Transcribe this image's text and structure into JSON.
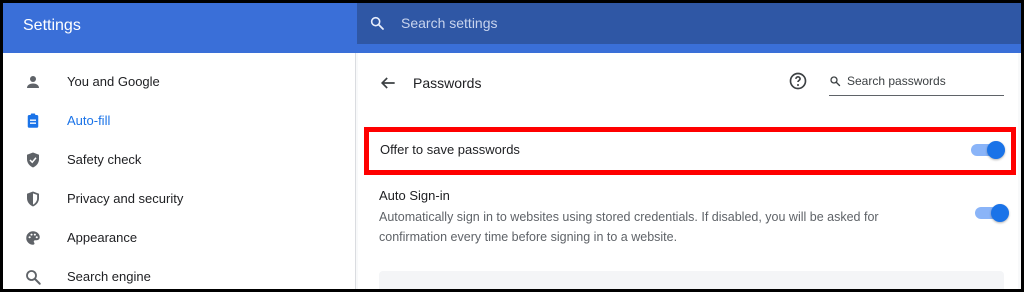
{
  "header": {
    "app_title": "Settings",
    "search_placeholder": "Search settings",
    "search_icon": "search-icon"
  },
  "sidebar": {
    "items": [
      {
        "label": "You and Google",
        "icon": "person-icon",
        "active": false
      },
      {
        "label": "Auto-fill",
        "icon": "clipboard-icon",
        "active": true
      },
      {
        "label": "Safety check",
        "icon": "shield-check-icon",
        "active": false
      },
      {
        "label": "Privacy and security",
        "icon": "shield-icon",
        "active": false
      },
      {
        "label": "Appearance",
        "icon": "palette-icon",
        "active": false
      },
      {
        "label": "Search engine",
        "icon": "search-icon",
        "active": false
      }
    ]
  },
  "passwords": {
    "title": "Passwords",
    "search_placeholder": "Search passwords",
    "offer_to_save": {
      "label": "Offer to save passwords",
      "enabled": true
    },
    "auto_signin": {
      "title": "Auto Sign-in",
      "description": "Automatically sign in to websites using stored credentials. If disabled, you will be asked for confirmation every time before signing in to a website.",
      "enabled": true
    }
  },
  "colors": {
    "accent": "#1a73e8",
    "header": "#3a6fd8",
    "highlight_border": "#ff0000"
  }
}
